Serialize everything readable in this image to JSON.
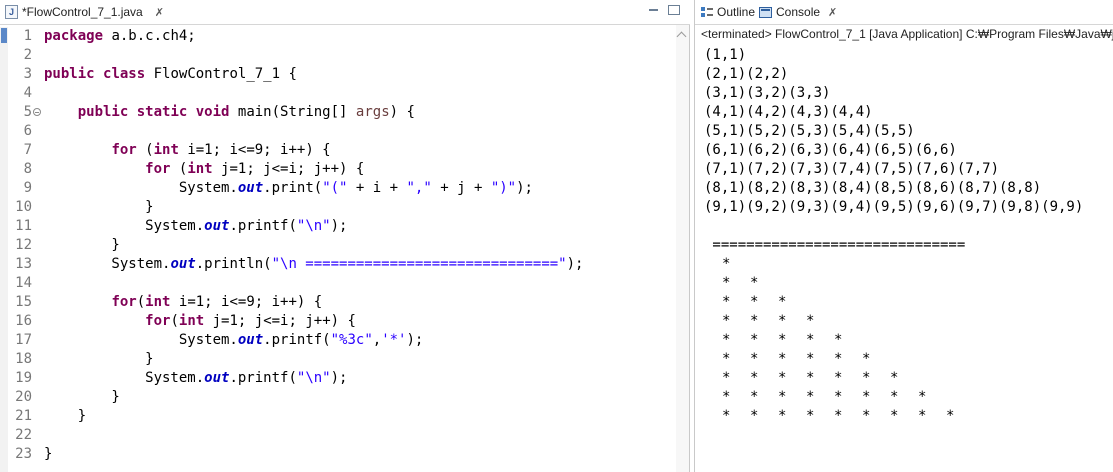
{
  "editor": {
    "tab_title": "*FlowControl_7_1.java",
    "tab_close": "✗",
    "lines": [
      {
        "n": "1",
        "c": [
          {
            "t": "kw",
            "v": "package"
          },
          {
            "t": "p",
            "v": " a.b.c.ch4;"
          }
        ]
      },
      {
        "n": "2",
        "c": []
      },
      {
        "n": "3",
        "c": [
          {
            "t": "kw",
            "v": "public"
          },
          {
            "t": "p",
            "v": " "
          },
          {
            "t": "kw",
            "v": "class"
          },
          {
            "t": "p",
            "v": " FlowControl_7_1 {"
          }
        ]
      },
      {
        "n": "4",
        "c": []
      },
      {
        "n": "5",
        "fold": true,
        "c": [
          {
            "t": "p",
            "v": "    "
          },
          {
            "t": "kw",
            "v": "public"
          },
          {
            "t": "p",
            "v": " "
          },
          {
            "t": "kw",
            "v": "static"
          },
          {
            "t": "p",
            "v": " "
          },
          {
            "t": "kw",
            "v": "void"
          },
          {
            "t": "p",
            "v": " main(String[] "
          },
          {
            "t": "arg",
            "v": "args"
          },
          {
            "t": "p",
            "v": ") {"
          }
        ]
      },
      {
        "n": "6",
        "c": []
      },
      {
        "n": "7",
        "c": [
          {
            "t": "p",
            "v": "        "
          },
          {
            "t": "kw",
            "v": "for"
          },
          {
            "t": "p",
            "v": " ("
          },
          {
            "t": "kw",
            "v": "int"
          },
          {
            "t": "p",
            "v": " i=1; i<=9; i++) {"
          }
        ]
      },
      {
        "n": "8",
        "c": [
          {
            "t": "p",
            "v": "            "
          },
          {
            "t": "kw",
            "v": "for"
          },
          {
            "t": "p",
            "v": " ("
          },
          {
            "t": "kw",
            "v": "int"
          },
          {
            "t": "p",
            "v": " j=1; j<=i; j++) {"
          }
        ]
      },
      {
        "n": "9",
        "c": [
          {
            "t": "p",
            "v": "                System."
          },
          {
            "t": "fld",
            "v": "out"
          },
          {
            "t": "p",
            "v": ".print("
          },
          {
            "t": "str",
            "v": "\"(\""
          },
          {
            "t": "p",
            "v": " + i + "
          },
          {
            "t": "str",
            "v": "\",\""
          },
          {
            "t": "p",
            "v": " + j + "
          },
          {
            "t": "str",
            "v": "\")\""
          },
          {
            "t": "p",
            "v": ");"
          }
        ]
      },
      {
        "n": "10",
        "c": [
          {
            "t": "p",
            "v": "            }"
          }
        ]
      },
      {
        "n": "11",
        "c": [
          {
            "t": "p",
            "v": "            System."
          },
          {
            "t": "fld",
            "v": "out"
          },
          {
            "t": "p",
            "v": ".printf("
          },
          {
            "t": "str",
            "v": "\"\\n\""
          },
          {
            "t": "p",
            "v": ");"
          }
        ]
      },
      {
        "n": "12",
        "c": [
          {
            "t": "p",
            "v": "        }"
          }
        ]
      },
      {
        "n": "13",
        "c": [
          {
            "t": "p",
            "v": "        System."
          },
          {
            "t": "fld",
            "v": "out"
          },
          {
            "t": "p",
            "v": ".println("
          },
          {
            "t": "str",
            "v": "\"\\n ==============================\""
          },
          {
            "t": "p",
            "v": ");"
          }
        ]
      },
      {
        "n": "14",
        "c": []
      },
      {
        "n": "15",
        "c": [
          {
            "t": "p",
            "v": "        "
          },
          {
            "t": "kw",
            "v": "for"
          },
          {
            "t": "p",
            "v": "("
          },
          {
            "t": "kw",
            "v": "int"
          },
          {
            "t": "p",
            "v": " i=1; i<=9; i++) {"
          }
        ]
      },
      {
        "n": "16",
        "c": [
          {
            "t": "p",
            "v": "            "
          },
          {
            "t": "kw",
            "v": "for"
          },
          {
            "t": "p",
            "v": "("
          },
          {
            "t": "kw",
            "v": "int"
          },
          {
            "t": "p",
            "v": " j=1; j<=i; j++) {"
          }
        ]
      },
      {
        "n": "17",
        "c": [
          {
            "t": "p",
            "v": "                System."
          },
          {
            "t": "fld",
            "v": "out"
          },
          {
            "t": "p",
            "v": ".printf("
          },
          {
            "t": "str",
            "v": "\"%3c\""
          },
          {
            "t": "p",
            "v": ","
          },
          {
            "t": "str",
            "v": "'*'"
          },
          {
            "t": "p",
            "v": ");"
          }
        ]
      },
      {
        "n": "18",
        "c": [
          {
            "t": "p",
            "v": "            }"
          }
        ]
      },
      {
        "n": "19",
        "c": [
          {
            "t": "p",
            "v": "            System."
          },
          {
            "t": "fld",
            "v": "out"
          },
          {
            "t": "p",
            "v": ".printf("
          },
          {
            "t": "str",
            "v": "\"\\n\""
          },
          {
            "t": "p",
            "v": ");"
          }
        ]
      },
      {
        "n": "20",
        "c": [
          {
            "t": "p",
            "v": "        }"
          }
        ]
      },
      {
        "n": "21",
        "c": [
          {
            "t": "p",
            "v": "    }"
          }
        ]
      },
      {
        "n": "22",
        "c": []
      },
      {
        "n": "23",
        "c": [
          {
            "t": "p",
            "v": "}"
          }
        ]
      }
    ]
  },
  "console": {
    "outline_tab": "Outline",
    "console_tab": "Console",
    "tab_close": "✗",
    "status": "<terminated> FlowControl_7_1 [Java Application] C:₩Program Files₩Java₩jd",
    "pairs": [
      "(1,1)",
      "(2,1)(2,2)",
      "(3,1)(3,2)(3,3)",
      "(4,1)(4,2)(4,3)(4,4)",
      "(5,1)(5,2)(5,3)(5,4)(5,5)",
      "(6,1)(6,2)(6,3)(6,4)(6,5)(6,6)",
      "(7,1)(7,2)(7,3)(7,4)(7,5)(7,6)(7,7)",
      "(8,1)(8,2)(8,3)(8,4)(8,5)(8,6)(8,7)(8,8)",
      "(9,1)(9,2)(9,3)(9,4)(9,5)(9,6)(9,7)(9,8)(9,9)"
    ],
    "separator": " ==============================",
    "star": "*",
    "star_rows": [
      1,
      2,
      3,
      4,
      5,
      6,
      7,
      8,
      9
    ]
  }
}
